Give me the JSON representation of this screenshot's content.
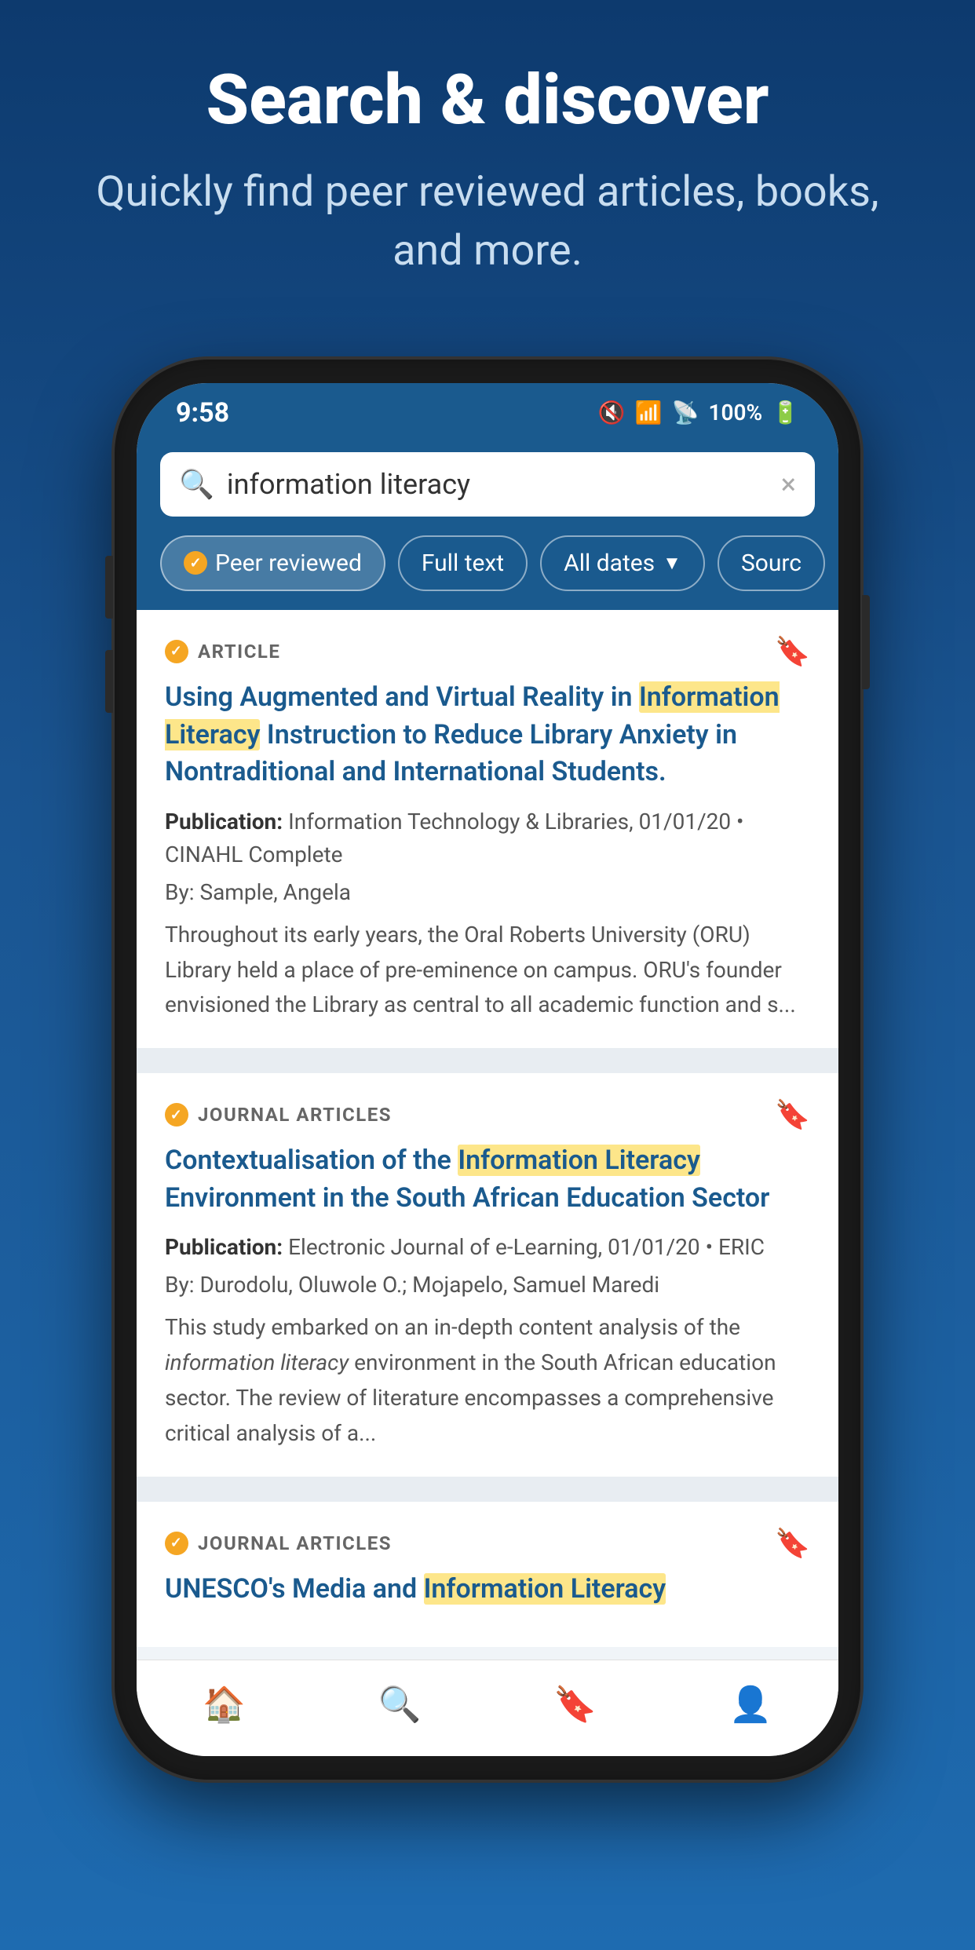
{
  "header": {
    "title": "Search & discover",
    "subtitle": "Quickly find peer reviewed articles, books, and more."
  },
  "status_bar": {
    "time": "9:58",
    "battery": "100%",
    "icons": [
      "mute",
      "wifi",
      "signal",
      "battery"
    ]
  },
  "search": {
    "query": "information literacy",
    "placeholder": "information literacy",
    "clear_label": "×"
  },
  "filters": [
    {
      "label": "Peer reviewed",
      "active": true,
      "has_check": true
    },
    {
      "label": "Full text",
      "active": false,
      "has_check": false
    },
    {
      "label": "All dates",
      "active": false,
      "has_check": false,
      "has_arrow": true
    },
    {
      "label": "Sourc",
      "active": false,
      "has_check": false,
      "truncated": true
    }
  ],
  "articles": [
    {
      "type": "ARTICLE",
      "title_before_highlight": "Using Augmented and Virtual Reality in ",
      "title_highlight": "Information Literacy",
      "title_after_highlight": " Instruction to Reduce Library Anxiety in Nontraditional and International Students.",
      "publication_label": "Publication:",
      "publication": "Information Technology & Libraries, 01/01/20",
      "database": "CINAHL Complete",
      "by_label": "By:",
      "author": "Sample, Angela",
      "abstract": "Throughout its early years, the Oral Roberts University (ORU) Library held a place of pre-eminence on campus. ORU's founder envisioned the Library as central to all academic function and s..."
    },
    {
      "type": "JOURNAL ARTICLES",
      "title_before_highlight": "Contextualisation of the ",
      "title_highlight": "Information Literacy",
      "title_after_highlight": " Environment in the South African Education Sector",
      "publication_label": "Publication:",
      "publication": "Electronic Journal of e-Learning, 01/01/20",
      "database": "ERIC",
      "by_label": "By:",
      "author": "Durodolu, Oluwole O.; Mojapelo, Samuel Maredi",
      "abstract_before": "This study embarked on an in-depth content analysis of the ",
      "abstract_italic": "information literacy",
      "abstract_after": " environment in the South African education sector. The review of literature encompasses a comprehensive critical analysis of a..."
    },
    {
      "type": "JOURNAL ARTICLES",
      "title_before_highlight": "UNESCO's Media and ",
      "title_highlight": "Information Literacy",
      "title_after_highlight": ""
    }
  ],
  "bottom_nav": [
    {
      "icon": "home",
      "label": "Home",
      "active": false
    },
    {
      "icon": "search",
      "label": "Search",
      "active": false
    },
    {
      "icon": "bookmark",
      "label": "Saved",
      "active": false
    },
    {
      "icon": "person",
      "label": "Account",
      "active": false
    }
  ]
}
